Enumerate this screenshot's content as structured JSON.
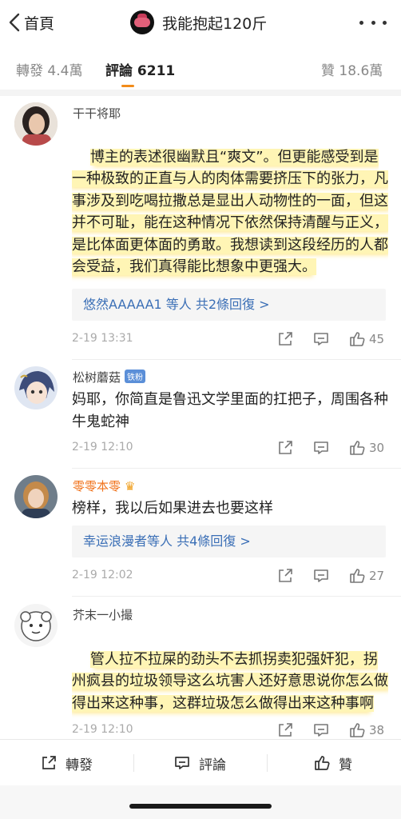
{
  "header": {
    "back_label": "首頁",
    "title": "我能抱起120斤"
  },
  "tabs": [
    {
      "label": "轉發 4.4萬",
      "active": false
    },
    {
      "label": "評論 6211",
      "active": true
    },
    {
      "label": "贊 18.6萬",
      "active": false
    }
  ],
  "comments": [
    {
      "user": "干干将耶",
      "text": "博主的表述很幽默且“爽文”。但更能感受到是一种极致的正直与人的肉体需要挤压下的张力，凡事涉及到吃喝拉撒总是显出人动物性的一面，但这并不可耻，能在这种情况下依然保持清醒与正义，是比体面更体面的勇敢。我想读到这段经历的人都会受益，我们真得能比想象中更强大。",
      "replies": "悠然AAAAA1 等人 共2條回復 >",
      "date": "2-19 13:31",
      "likes": "45"
    },
    {
      "user": "松树蘑菇",
      "badge": "铁粉",
      "text": "妈耶，你简直是鲁迅文学里面的扛把子，周围各种牛鬼蛇神",
      "date": "2-19 12:10",
      "likes": "30"
    },
    {
      "user": "零零本零",
      "crown": "♛",
      "text": "榜样，我以后如果进去也要这样",
      "replies": "幸运浪漫者等人 共4條回復 >",
      "date": "2-19 12:02",
      "likes": "27"
    },
    {
      "user": "芥末一小撮",
      "text": "管人拉不拉屎的劲头不去抓拐卖犯强奸犯，拐州疯县的垃圾领导这么坑害人还好意思说你怎么做得出来这种事，这群垃圾怎么做得出来这种事啊",
      "date": "2-19 12:10",
      "likes": "38"
    }
  ],
  "bottombar": {
    "repost": "轉發",
    "comment": "評論",
    "like": "贊"
  },
  "colors": {
    "accent": "#f28c1a",
    "link": "#3b6fb6",
    "highlight": "#ffec78"
  }
}
